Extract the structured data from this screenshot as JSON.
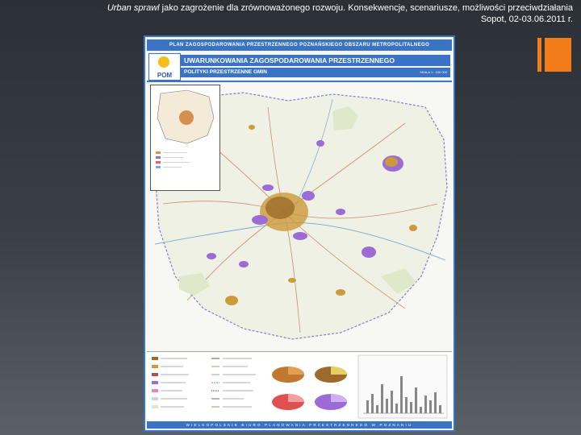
{
  "slide": {
    "header_italic": "Urban sprawl",
    "header_rest": " jako zagrożenie dla zrównoważonego rozwoju. Konsekwencje, scenariusze, możliwości przeciwdziałania",
    "header_line2": "Sopot, 02-03.06.2011 r.",
    "accent_color": "#f07c1a"
  },
  "poster": {
    "plan_title": "PLAN ZAGOSPODAROWANIA PRZESTRZENNEGO POZNAŃSKIEGO OBSZARU METROPOLITALNEGO",
    "logo_text": "POM",
    "main_title": "UWARUNKOWANIA ZAGOSPODAROWANIA PRZESTRZENNEGO",
    "sub_title": "POLITYKI PRZESTRZENNE GMIN",
    "scale": "SKALA 1 : 100 000",
    "footer": "WIELKOPOLSKIE BIURO PLANOWANIA PRZESTRZENNEGO W POZNANIU",
    "frame_color": "#3a73c4"
  }
}
